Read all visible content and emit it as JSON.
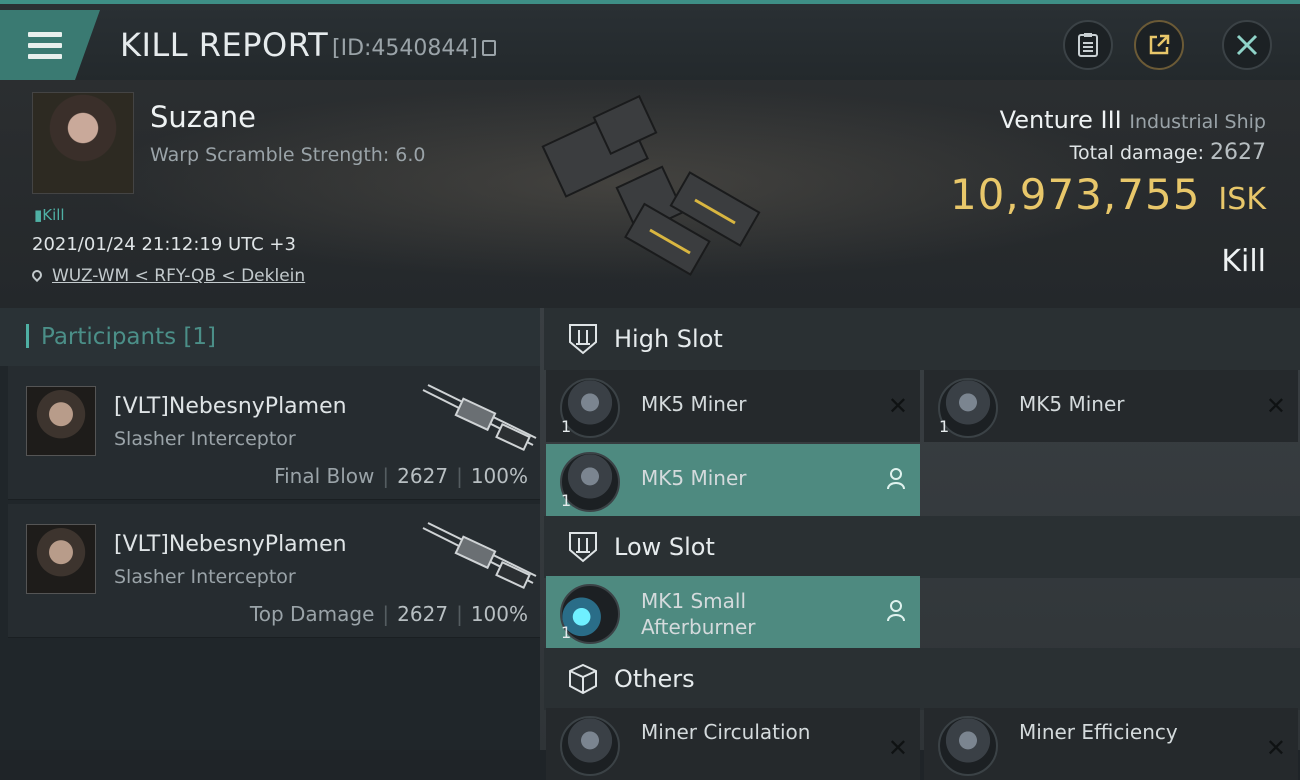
{
  "header": {
    "title": "KILL REPORT",
    "report_id": "[ID:4540844]"
  },
  "victim": {
    "name": "Suzane",
    "warp_scramble": "Warp Scramble Strength: 6.0",
    "tag": "Kill",
    "datetime": "2021/01/24 21:12:19 UTC +3",
    "location": "WUZ-WM < RFY-QB < Deklein",
    "ship_name": "Venture III",
    "ship_class": "Industrial Ship",
    "total_damage_label": "Total damage:",
    "total_damage_value": "2627",
    "isk_value": "10,973,755",
    "isk_currency": "ISK",
    "result": "Kill"
  },
  "participants": {
    "heading": "Participants [1]",
    "items": [
      {
        "name": "[VLT]NebesnyPlamen",
        "ship": "Slasher Interceptor",
        "role": "Final Blow",
        "damage": "2627",
        "percent": "100%"
      },
      {
        "name": "[VLT]NebesnyPlamen",
        "ship": "Slasher Interceptor",
        "role": "Top Damage",
        "damage": "2627",
        "percent": "100%"
      }
    ]
  },
  "fittings": {
    "high_slot": {
      "title": "High Slot",
      "modules": [
        {
          "qty": "1",
          "name": "MK5 Miner",
          "state": "destroyed"
        },
        {
          "qty": "1",
          "name": "MK5 Miner",
          "state": "destroyed"
        },
        {
          "qty": "1",
          "name": "MK5 Miner",
          "state": "dropped"
        }
      ]
    },
    "low_slot": {
      "title": "Low Slot",
      "modules": [
        {
          "qty": "1",
          "name_line1": "MK1 Small",
          "name_line2": "Afterburner",
          "state": "dropped"
        }
      ]
    },
    "others": {
      "title": "Others",
      "modules": [
        {
          "qty": "1",
          "name": "Miner Circulation",
          "state": "destroyed"
        },
        {
          "qty": "1",
          "name": "Miner Efficiency",
          "state": "destroyed"
        }
      ]
    }
  },
  "colors": {
    "accent": "#4fb0a4",
    "isk": "#e8c76a",
    "active_module": "#4e8a80"
  }
}
